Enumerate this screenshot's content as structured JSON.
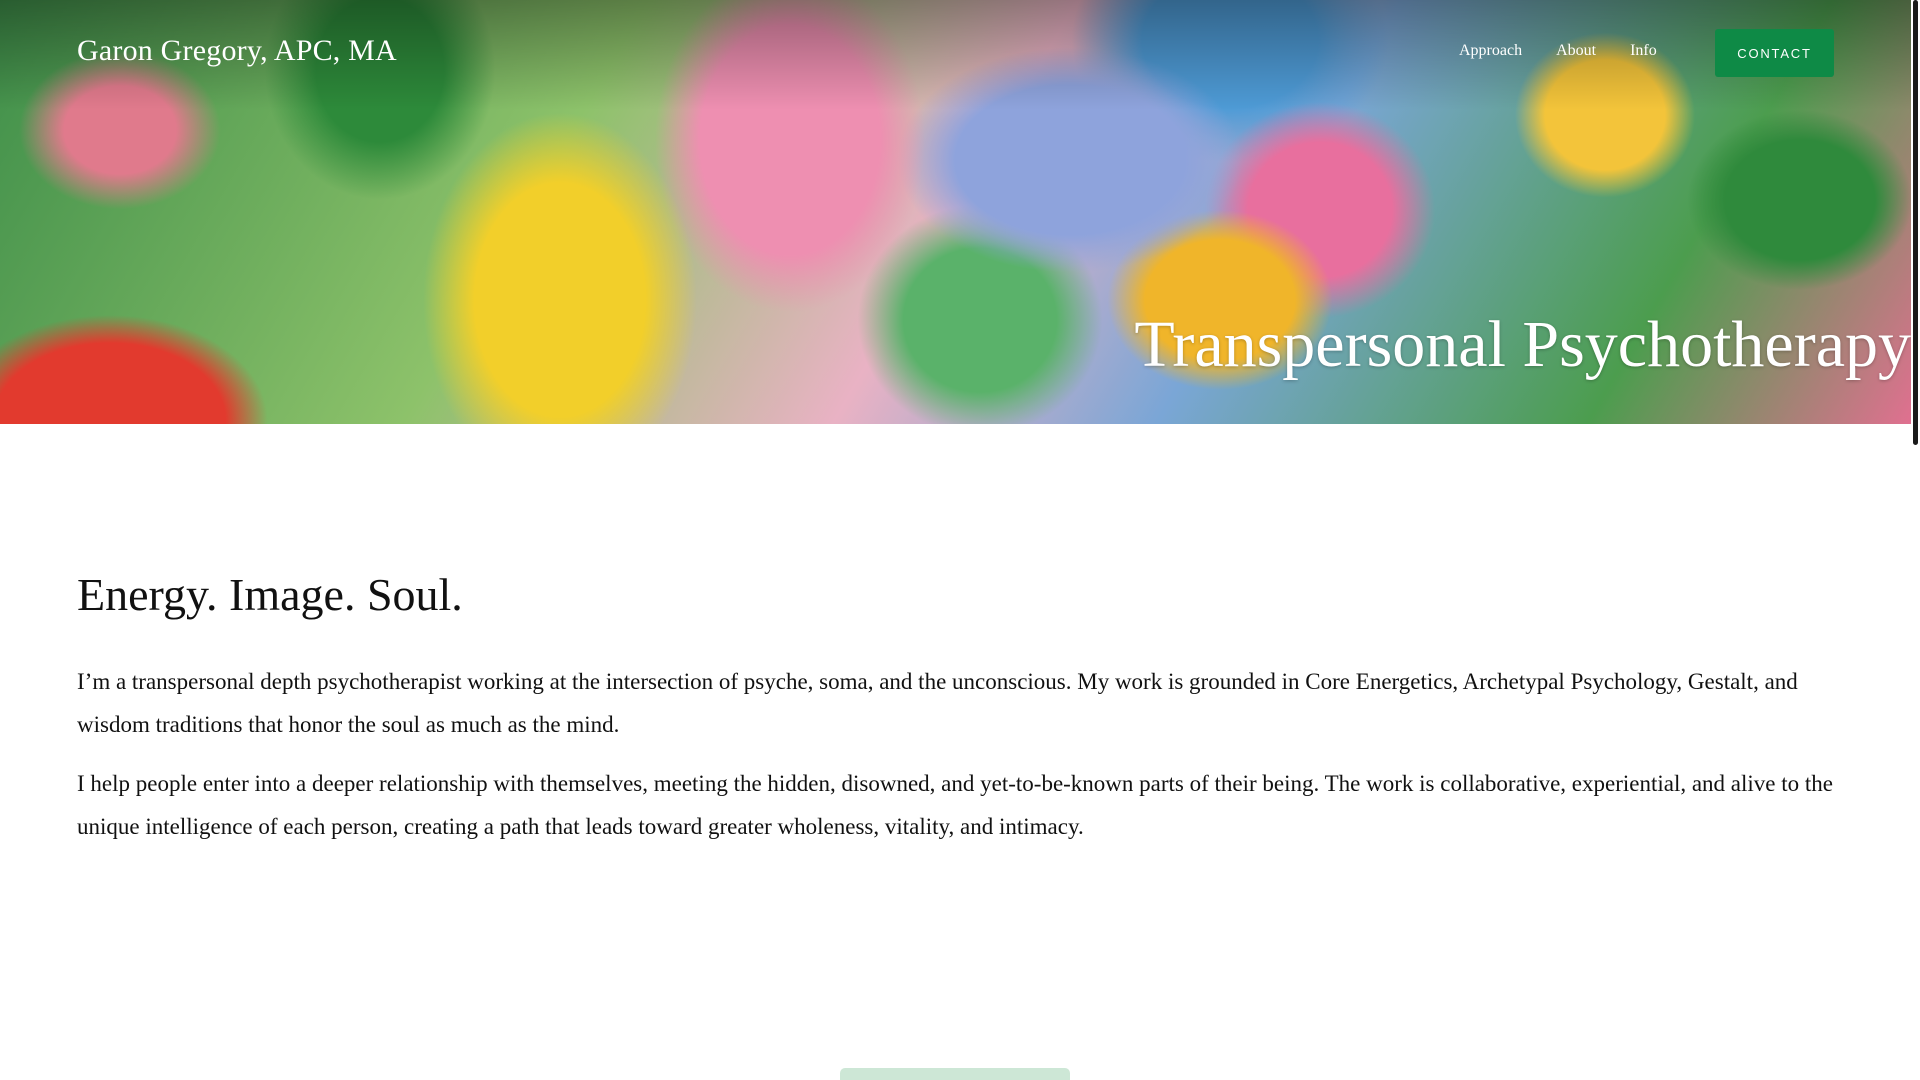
{
  "header": {
    "site_title": "Garon Gregory, APC, MA",
    "nav": [
      {
        "label": "Approach"
      },
      {
        "label": "About"
      },
      {
        "label": "Info"
      }
    ],
    "contact_label": "CONTACT",
    "accent_color": "#0e8a46"
  },
  "hero": {
    "heading": "Transpersonal Psychotherapy"
  },
  "main": {
    "heading": "Energy. Image. Soul.",
    "paragraphs": [
      "I’m a transpersonal depth psychotherapist working at the intersection of psyche, soma, and the unconscious. My work is grounded in Core Energetics, Archetypal Psychology, Gestalt, and wisdom traditions that honor the soul as much as the mind.",
      "I help people enter into a deeper relationship with themselves, meeting the hidden, disowned, and yet-to-be-known parts of their being. The work is collaborative, experiential, and alive to the unique intelligence of each person, creating a path that leads toward greater wholeness, vitality, and intimacy."
    ]
  }
}
